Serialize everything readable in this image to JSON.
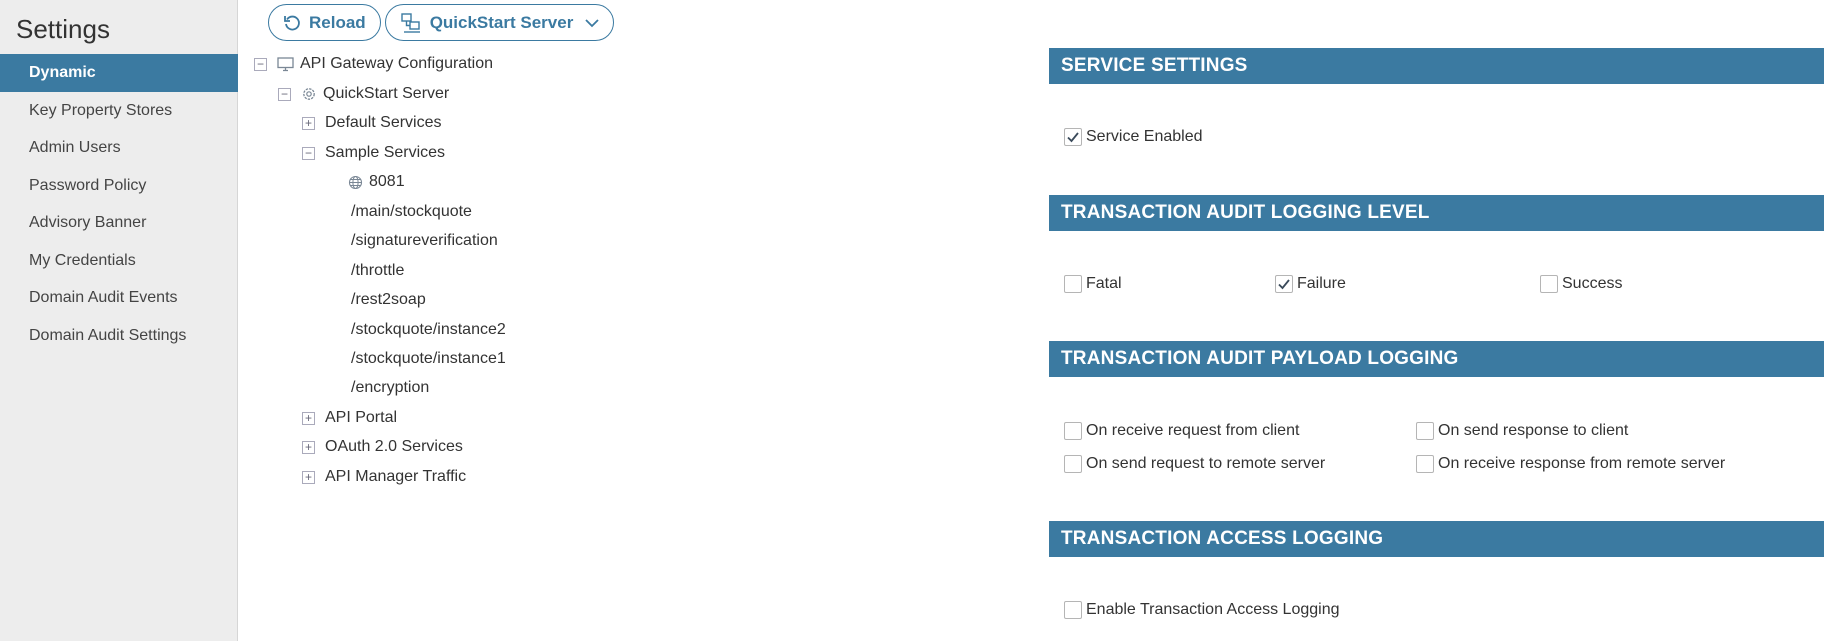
{
  "sidebar": {
    "title": "Settings",
    "items": [
      {
        "label": "Dynamic",
        "active": true
      },
      {
        "label": "Key Property Stores"
      },
      {
        "label": "Admin Users"
      },
      {
        "label": "Password Policy"
      },
      {
        "label": "Advisory Banner"
      },
      {
        "label": "My Credentials"
      },
      {
        "label": "Domain Audit Events"
      },
      {
        "label": "Domain Audit Settings"
      }
    ]
  },
  "toolbar": {
    "reload_label": "Reload",
    "server_label": "QuickStart Server"
  },
  "tree": {
    "root": "API Gateway Configuration",
    "server": "QuickStart Server",
    "default_services": "Default Services",
    "sample_services": "Sample Services",
    "port": "8081",
    "paths": [
      "/main/stockquote",
      "/signatureverification",
      "/throttle",
      "/rest2soap",
      "/stockquote/instance2",
      "/stockquote/instance1",
      "/encryption"
    ],
    "api_portal": "API Portal",
    "oauth": "OAuth 2.0 Services",
    "api_manager": "API Manager Traffic"
  },
  "panel": {
    "service_settings": {
      "heading": "SERVICE SETTINGS",
      "service_enabled": {
        "label": "Service Enabled",
        "checked": true
      }
    },
    "audit_logging_level": {
      "heading": "TRANSACTION AUDIT LOGGING LEVEL",
      "fatal": {
        "label": "Fatal",
        "checked": false
      },
      "failure": {
        "label": "Failure",
        "checked": true
      },
      "success": {
        "label": "Success",
        "checked": false
      }
    },
    "payload_logging": {
      "heading": "TRANSACTION AUDIT PAYLOAD LOGGING",
      "recv_from_client": {
        "label": "On receive request from client",
        "checked": false
      },
      "send_to_client": {
        "label": "On send response to client",
        "checked": false
      },
      "send_to_remote": {
        "label": "On send request to remote server",
        "checked": false
      },
      "recv_from_remote": {
        "label": "On receive response from remote server",
        "checked": false
      }
    },
    "access_logging": {
      "heading": "TRANSACTION ACCESS LOGGING",
      "enable": {
        "label": "Enable Transaction Access Logging",
        "checked": false
      }
    }
  },
  "colors": {
    "accent": "#3b7aa1",
    "sidebar_bg": "#ededed"
  }
}
